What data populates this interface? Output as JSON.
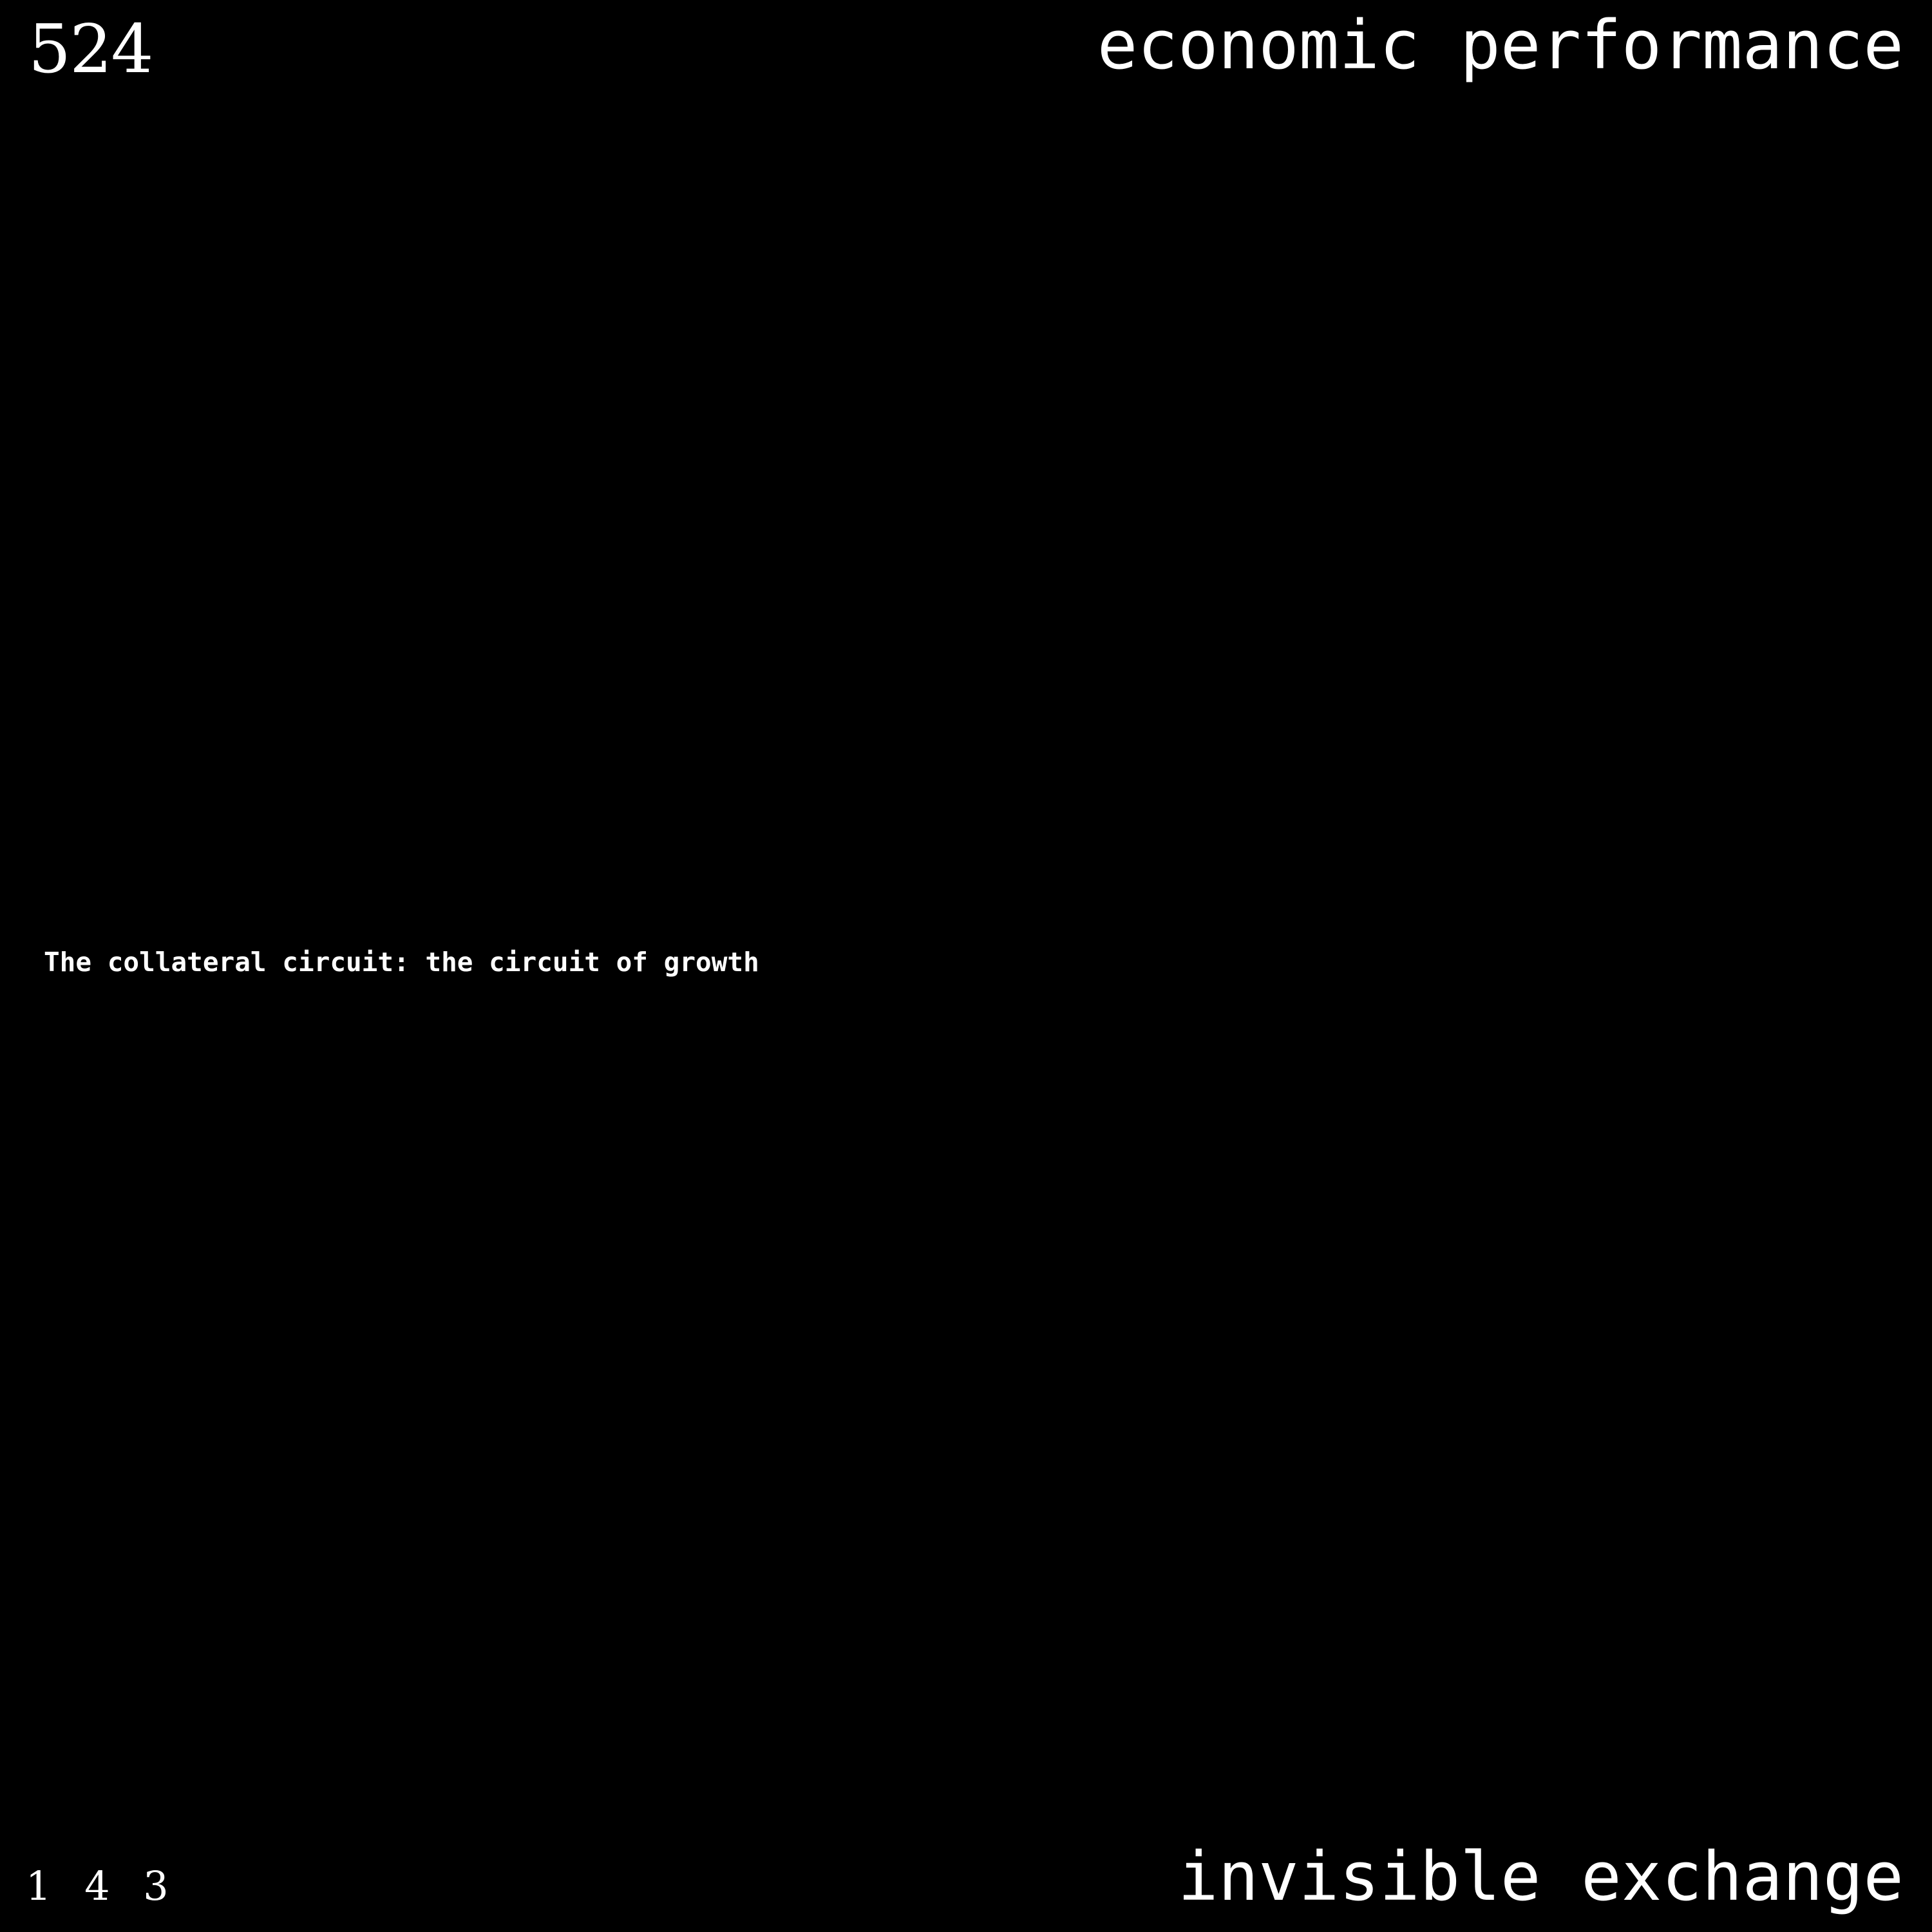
{
  "header": {
    "number": "524",
    "title": "economic performance"
  },
  "main": {
    "caption": "The collateral circuit: the circuit of growth"
  },
  "footer": {
    "numbers": "1 4 3",
    "title": "invisible exchange"
  }
}
